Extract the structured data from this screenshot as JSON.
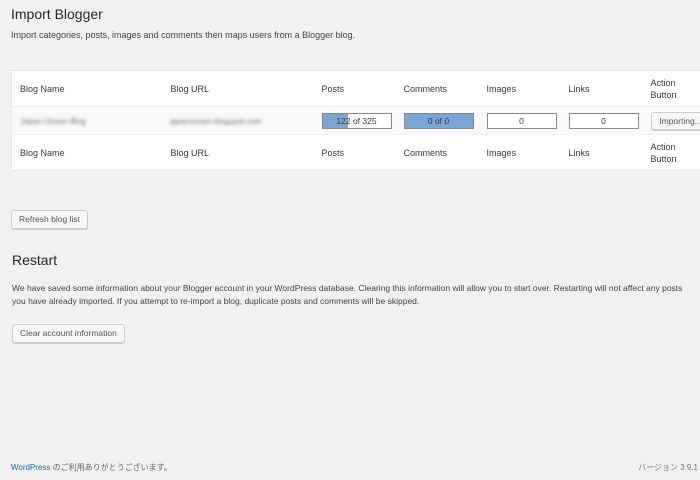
{
  "page": {
    "title": "Import Blogger",
    "description": "Import categories, posts, images and comments then maps users from a Blogger blog."
  },
  "table": {
    "headers": [
      "Blog Name",
      "Blog URL",
      "Posts",
      "Comments",
      "Images",
      "Links",
      "Action Button"
    ],
    "header_action_line1": "Action",
    "header_action_line2": "Button",
    "row": {
      "blog_name": "Japan Onsen Blog",
      "blog_url": "japanonsen.blogspot.com",
      "posts_text": "122 of 325",
      "posts_progress": 0.38,
      "comments_text": "0 of 0",
      "comments_progress": 1.0,
      "images": "0",
      "links": "0",
      "action_label": "Importing..."
    },
    "progress_color": "#7aa6d6"
  },
  "refresh_label": "Refresh blog list",
  "restart": {
    "title": "Restart",
    "description": "We have saved some information about your Blogger account in your WordPress database. Clearing this information will allow you to start over. Restarting will not affect any posts you have already imported. If you attempt to re-import a blog, duplicate posts and comments will be skipped.",
    "clear_label": "Clear account information"
  },
  "footer": {
    "wordpress_link": "WordPress",
    "thanks_text": " のご利用ありがとうございます。",
    "version": "バージョン 3.9.1"
  }
}
